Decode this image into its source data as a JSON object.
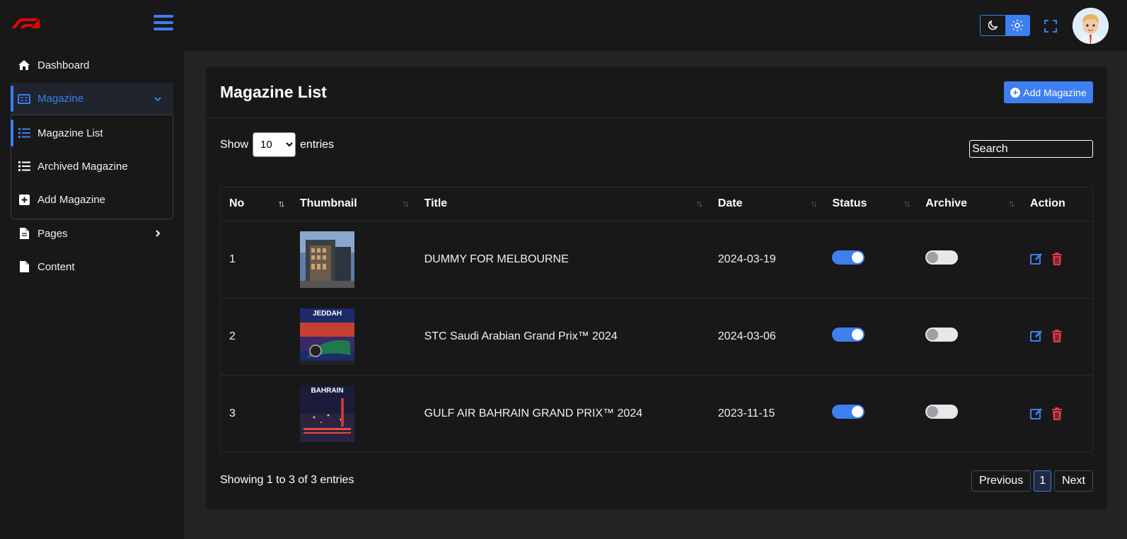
{
  "header": {
    "logo_icon": "f1-logo-icon",
    "menu_icon": "hamburger-icon",
    "theme": {
      "dark_icon": "moon-icon",
      "light_icon": "sun-icon",
      "active": "light"
    },
    "fullscreen_icon": "fullscreen-icon",
    "avatar_icon": "user-avatar"
  },
  "sidebar": {
    "items": [
      {
        "label": "Dashboard",
        "icon": "home-icon"
      },
      {
        "label": "Magazine",
        "icon": "newspaper-icon",
        "expanded": true
      },
      {
        "label": "Magazine List",
        "icon": "list-icon",
        "active": true
      },
      {
        "label": "Archived Magazine",
        "icon": "list-icon"
      },
      {
        "label": "Add Magazine",
        "icon": "plus-square-icon"
      },
      {
        "label": "Pages",
        "icon": "file-icon"
      },
      {
        "label": "Content",
        "icon": "file-icon"
      }
    ]
  },
  "main": {
    "title": "Magazine List",
    "add_button": "Add Magazine",
    "show_label": "Show",
    "entries_label": "entries",
    "page_size": "10",
    "search_placeholder": "Search",
    "columns": [
      "No",
      "Thumbnail",
      "Title",
      "Date",
      "Status",
      "Archive",
      "Action"
    ],
    "rows": [
      {
        "no": "1",
        "title": "DUMMY FOR MELBOURNE",
        "date": "2024-03-19",
        "status": true,
        "archive": false
      },
      {
        "no": "2",
        "title": "STC Saudi Arabian Grand Prix™ 2024",
        "date": "2024-03-06",
        "status": true,
        "archive": false
      },
      {
        "no": "3",
        "title": "GULF AIR BAHRAIN GRAND PRIX™ 2024",
        "date": "2023-11-15",
        "status": true,
        "archive": false
      }
    ],
    "thumb_text": {
      "row2": "JEDDAH",
      "row3": "BAHRAIN"
    },
    "info": "Showing 1 to 3 of 3 entries",
    "pagination": {
      "previous": "Previous",
      "current": "1",
      "next": "Next"
    }
  },
  "colors": {
    "accent": "#3d7ff0",
    "danger": "#e5374d",
    "background": "#232323",
    "panel": "#181818"
  }
}
